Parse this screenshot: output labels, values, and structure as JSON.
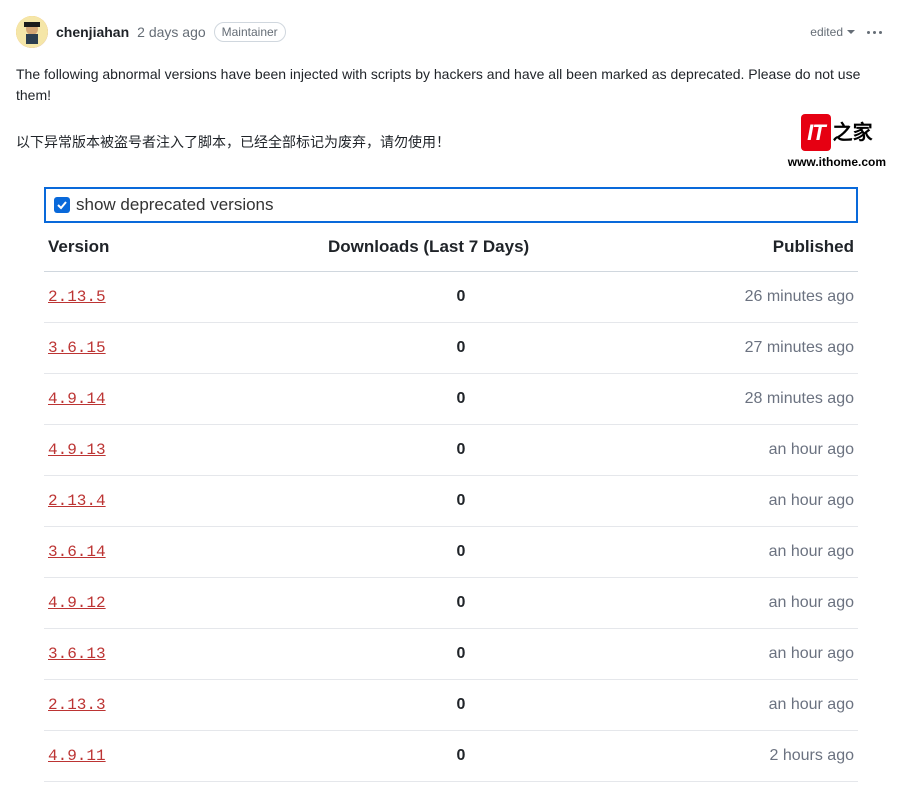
{
  "header": {
    "username": "chenjiahan",
    "timestamp": "2 days ago",
    "badge": "Maintainer",
    "edited_label": "edited"
  },
  "body": {
    "text_en": "The following abnormal versions have been injected with scripts by hackers and have all been marked as deprecated. Please do not use them!",
    "text_cn": "以下异常版本被盗号者注入了脚本，已经全部标记为废弃，请勿使用！"
  },
  "watermark": {
    "logo_text": "IT",
    "suffix": "之家",
    "url": "www.ithome.com"
  },
  "versions_panel": {
    "checkbox_label": "show deprecated versions",
    "columns": {
      "version": "Version",
      "downloads": "Downloads (Last 7 Days)",
      "published": "Published"
    },
    "rows": [
      {
        "version": "2.13.5",
        "downloads": "0",
        "published": "26 minutes ago"
      },
      {
        "version": "3.6.15",
        "downloads": "0",
        "published": "27 minutes ago"
      },
      {
        "version": "4.9.14",
        "downloads": "0",
        "published": "28 minutes ago"
      },
      {
        "version": "4.9.13",
        "downloads": "0",
        "published": "an hour ago"
      },
      {
        "version": "2.13.4",
        "downloads": "0",
        "published": "an hour ago"
      },
      {
        "version": "3.6.14",
        "downloads": "0",
        "published": "an hour ago"
      },
      {
        "version": "4.9.12",
        "downloads": "0",
        "published": "an hour ago"
      },
      {
        "version": "3.6.13",
        "downloads": "0",
        "published": "an hour ago"
      },
      {
        "version": "2.13.3",
        "downloads": "0",
        "published": "an hour ago"
      },
      {
        "version": "4.9.11",
        "downloads": "0",
        "published": "2 hours ago"
      }
    ]
  }
}
